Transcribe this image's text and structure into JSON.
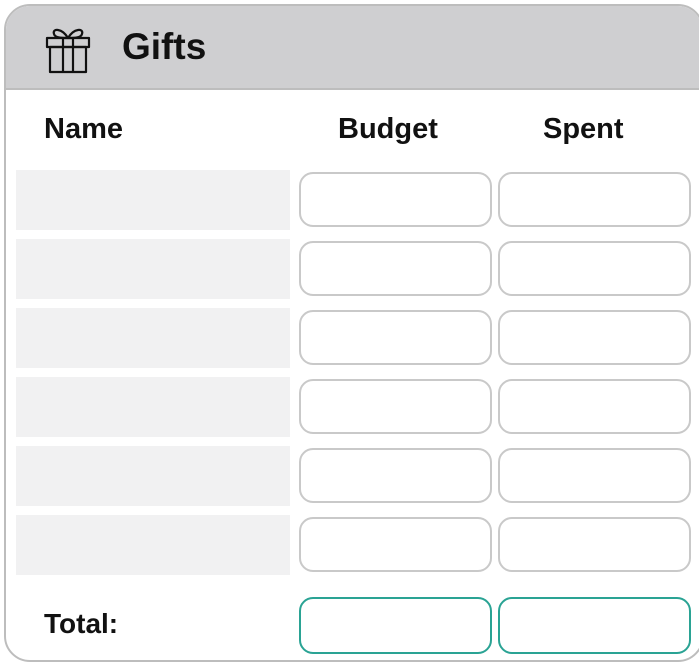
{
  "card": {
    "title": "Gifts",
    "icon": "gift-icon"
  },
  "columns": {
    "name": "Name",
    "budget": "Budget",
    "spent": "Spent"
  },
  "rows": [
    {
      "name": "",
      "budget": "",
      "spent": ""
    },
    {
      "name": "",
      "budget": "",
      "spent": ""
    },
    {
      "name": "",
      "budget": "",
      "spent": ""
    },
    {
      "name": "",
      "budget": "",
      "spent": ""
    },
    {
      "name": "",
      "budget": "",
      "spent": ""
    },
    {
      "name": "",
      "budget": "",
      "spent": ""
    }
  ],
  "total": {
    "label": "Total:",
    "budget": "",
    "spent": ""
  },
  "colors": {
    "header_bg": "#cfcfd1",
    "name_cell_bg": "#f1f1f2",
    "input_border": "#c9c9c9",
    "total_border": "#2aa394"
  }
}
